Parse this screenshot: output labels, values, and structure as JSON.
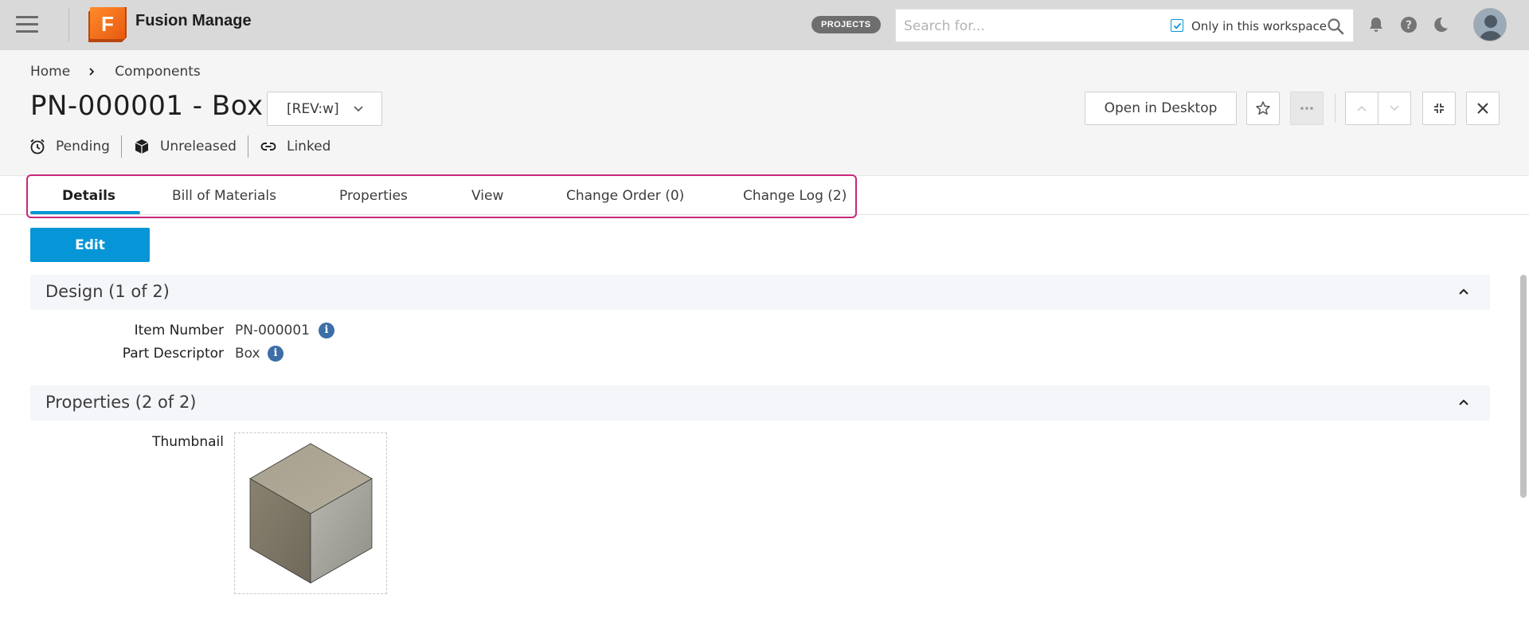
{
  "topbar": {
    "app_title": "Fusion Manage",
    "logo_letter": "F",
    "projects_badge": "PROJECTS",
    "search": {
      "placeholder": "Search for...",
      "value": "",
      "workspace_only_label": "Only in this workspace",
      "workspace_only_checked": true
    },
    "icons": [
      "menu-icon",
      "search-icon",
      "bell-icon",
      "help-icon",
      "moon-icon",
      "avatar"
    ]
  },
  "breadcrumb": {
    "items": [
      "Home",
      "Components"
    ]
  },
  "item": {
    "title": "PN-000001 - Box",
    "revision": "[REV:w]",
    "status": {
      "workflow": "Pending",
      "lifecycle": "Unreleased",
      "link": "Linked"
    }
  },
  "actions": {
    "open_in_desktop": "Open in Desktop",
    "icons": [
      "star-icon",
      "more-icon",
      "chevron-up-icon",
      "chevron-down-icon",
      "collapse-icon",
      "close-icon"
    ]
  },
  "tabs": [
    {
      "label": "Details",
      "active": true
    },
    {
      "label": "Bill of Materials",
      "active": false
    },
    {
      "label": "Properties",
      "active": false
    },
    {
      "label": "View",
      "active": false
    },
    {
      "label": "Change Order (0)",
      "active": false
    },
    {
      "label": "Change Log (2)",
      "active": false
    }
  ],
  "edit_label": "Edit",
  "sections": [
    {
      "title": "Design (1 of 2)",
      "fields": [
        {
          "label": "Item Number",
          "value": "PN-000001"
        },
        {
          "label": "Part Descriptor",
          "value": "Box"
        }
      ]
    },
    {
      "title": "Properties (2 of 2)",
      "fields": [
        {
          "label": "Thumbnail",
          "value": ""
        }
      ]
    }
  ],
  "colors": {
    "accent": "#0696d7",
    "tab_highlight": "#c8277a",
    "topbar": "#d9d9d9",
    "logo": "#f26a1b"
  }
}
